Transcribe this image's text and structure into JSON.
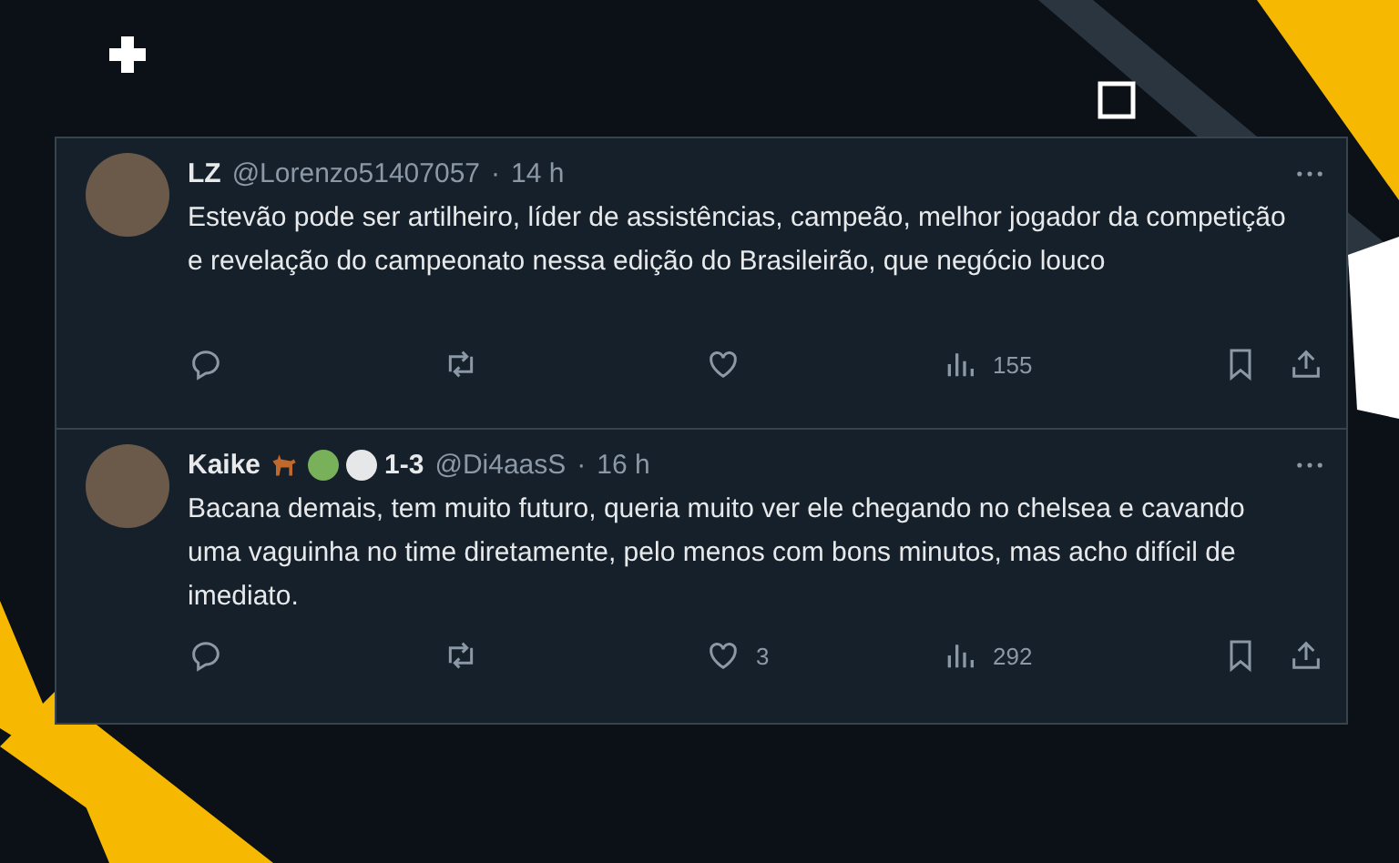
{
  "tweets": [
    {
      "name": "LZ",
      "handle": "@Lorenzo51407057",
      "separator": "·",
      "time": "14 h",
      "text": "Estevão pode ser artilheiro, líder de assistências, campeão, melhor jogador da competição e revelação do campeonato nessa edição do Brasileirão, que negócio louco",
      "views": "155"
    },
    {
      "name": "Kaike",
      "badges": [
        {
          "kind": "animal"
        },
        {
          "kind": "dot",
          "color": "#78b159"
        },
        {
          "kind": "dot",
          "color": "#e6e7e8"
        }
      ],
      "suffix": "1-3",
      "handle": "@Di4aasS",
      "separator": "·",
      "time": "16 h",
      "text": "Bacana demais, tem muito futuro, queria muito ver ele chegando no chelsea e cavando uma vaguinha no time diretamente, pelo menos com bons minutos, mas acho difícil de imediato.",
      "likes": "3",
      "views": "292"
    }
  ]
}
